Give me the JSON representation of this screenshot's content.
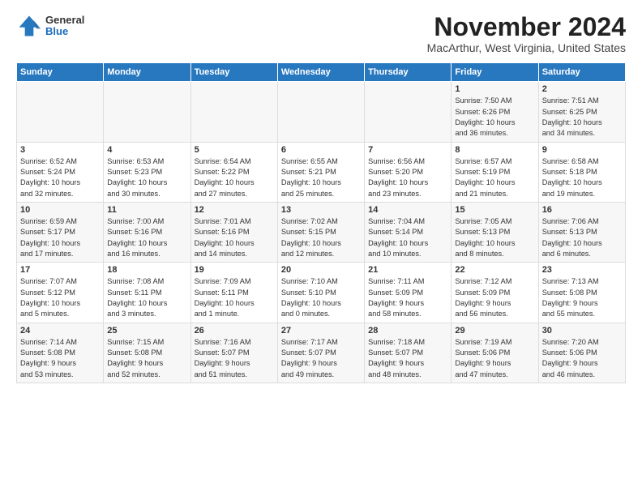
{
  "logo": {
    "general": "General",
    "blue": "Blue"
  },
  "title": "November 2024",
  "subtitle": "MacArthur, West Virginia, United States",
  "days_of_week": [
    "Sunday",
    "Monday",
    "Tuesday",
    "Wednesday",
    "Thursday",
    "Friday",
    "Saturday"
  ],
  "weeks": [
    [
      {
        "day": "",
        "content": ""
      },
      {
        "day": "",
        "content": ""
      },
      {
        "day": "",
        "content": ""
      },
      {
        "day": "",
        "content": ""
      },
      {
        "day": "",
        "content": ""
      },
      {
        "day": "1",
        "content": "Sunrise: 7:50 AM\nSunset: 6:26 PM\nDaylight: 10 hours\nand 36 minutes."
      },
      {
        "day": "2",
        "content": "Sunrise: 7:51 AM\nSunset: 6:25 PM\nDaylight: 10 hours\nand 34 minutes."
      }
    ],
    [
      {
        "day": "3",
        "content": "Sunrise: 6:52 AM\nSunset: 5:24 PM\nDaylight: 10 hours\nand 32 minutes."
      },
      {
        "day": "4",
        "content": "Sunrise: 6:53 AM\nSunset: 5:23 PM\nDaylight: 10 hours\nand 30 minutes."
      },
      {
        "day": "5",
        "content": "Sunrise: 6:54 AM\nSunset: 5:22 PM\nDaylight: 10 hours\nand 27 minutes."
      },
      {
        "day": "6",
        "content": "Sunrise: 6:55 AM\nSunset: 5:21 PM\nDaylight: 10 hours\nand 25 minutes."
      },
      {
        "day": "7",
        "content": "Sunrise: 6:56 AM\nSunset: 5:20 PM\nDaylight: 10 hours\nand 23 minutes."
      },
      {
        "day": "8",
        "content": "Sunrise: 6:57 AM\nSunset: 5:19 PM\nDaylight: 10 hours\nand 21 minutes."
      },
      {
        "day": "9",
        "content": "Sunrise: 6:58 AM\nSunset: 5:18 PM\nDaylight: 10 hours\nand 19 minutes."
      }
    ],
    [
      {
        "day": "10",
        "content": "Sunrise: 6:59 AM\nSunset: 5:17 PM\nDaylight: 10 hours\nand 17 minutes."
      },
      {
        "day": "11",
        "content": "Sunrise: 7:00 AM\nSunset: 5:16 PM\nDaylight: 10 hours\nand 16 minutes."
      },
      {
        "day": "12",
        "content": "Sunrise: 7:01 AM\nSunset: 5:16 PM\nDaylight: 10 hours\nand 14 minutes."
      },
      {
        "day": "13",
        "content": "Sunrise: 7:02 AM\nSunset: 5:15 PM\nDaylight: 10 hours\nand 12 minutes."
      },
      {
        "day": "14",
        "content": "Sunrise: 7:04 AM\nSunset: 5:14 PM\nDaylight: 10 hours\nand 10 minutes."
      },
      {
        "day": "15",
        "content": "Sunrise: 7:05 AM\nSunset: 5:13 PM\nDaylight: 10 hours\nand 8 minutes."
      },
      {
        "day": "16",
        "content": "Sunrise: 7:06 AM\nSunset: 5:13 PM\nDaylight: 10 hours\nand 6 minutes."
      }
    ],
    [
      {
        "day": "17",
        "content": "Sunrise: 7:07 AM\nSunset: 5:12 PM\nDaylight: 10 hours\nand 5 minutes."
      },
      {
        "day": "18",
        "content": "Sunrise: 7:08 AM\nSunset: 5:11 PM\nDaylight: 10 hours\nand 3 minutes."
      },
      {
        "day": "19",
        "content": "Sunrise: 7:09 AM\nSunset: 5:11 PM\nDaylight: 10 hours\nand 1 minute."
      },
      {
        "day": "20",
        "content": "Sunrise: 7:10 AM\nSunset: 5:10 PM\nDaylight: 10 hours\nand 0 minutes."
      },
      {
        "day": "21",
        "content": "Sunrise: 7:11 AM\nSunset: 5:09 PM\nDaylight: 9 hours\nand 58 minutes."
      },
      {
        "day": "22",
        "content": "Sunrise: 7:12 AM\nSunset: 5:09 PM\nDaylight: 9 hours\nand 56 minutes."
      },
      {
        "day": "23",
        "content": "Sunrise: 7:13 AM\nSunset: 5:08 PM\nDaylight: 9 hours\nand 55 minutes."
      }
    ],
    [
      {
        "day": "24",
        "content": "Sunrise: 7:14 AM\nSunset: 5:08 PM\nDaylight: 9 hours\nand 53 minutes."
      },
      {
        "day": "25",
        "content": "Sunrise: 7:15 AM\nSunset: 5:08 PM\nDaylight: 9 hours\nand 52 minutes."
      },
      {
        "day": "26",
        "content": "Sunrise: 7:16 AM\nSunset: 5:07 PM\nDaylight: 9 hours\nand 51 minutes."
      },
      {
        "day": "27",
        "content": "Sunrise: 7:17 AM\nSunset: 5:07 PM\nDaylight: 9 hours\nand 49 minutes."
      },
      {
        "day": "28",
        "content": "Sunrise: 7:18 AM\nSunset: 5:07 PM\nDaylight: 9 hours\nand 48 minutes."
      },
      {
        "day": "29",
        "content": "Sunrise: 7:19 AM\nSunset: 5:06 PM\nDaylight: 9 hours\nand 47 minutes."
      },
      {
        "day": "30",
        "content": "Sunrise: 7:20 AM\nSunset: 5:06 PM\nDaylight: 9 hours\nand 46 minutes."
      }
    ]
  ]
}
